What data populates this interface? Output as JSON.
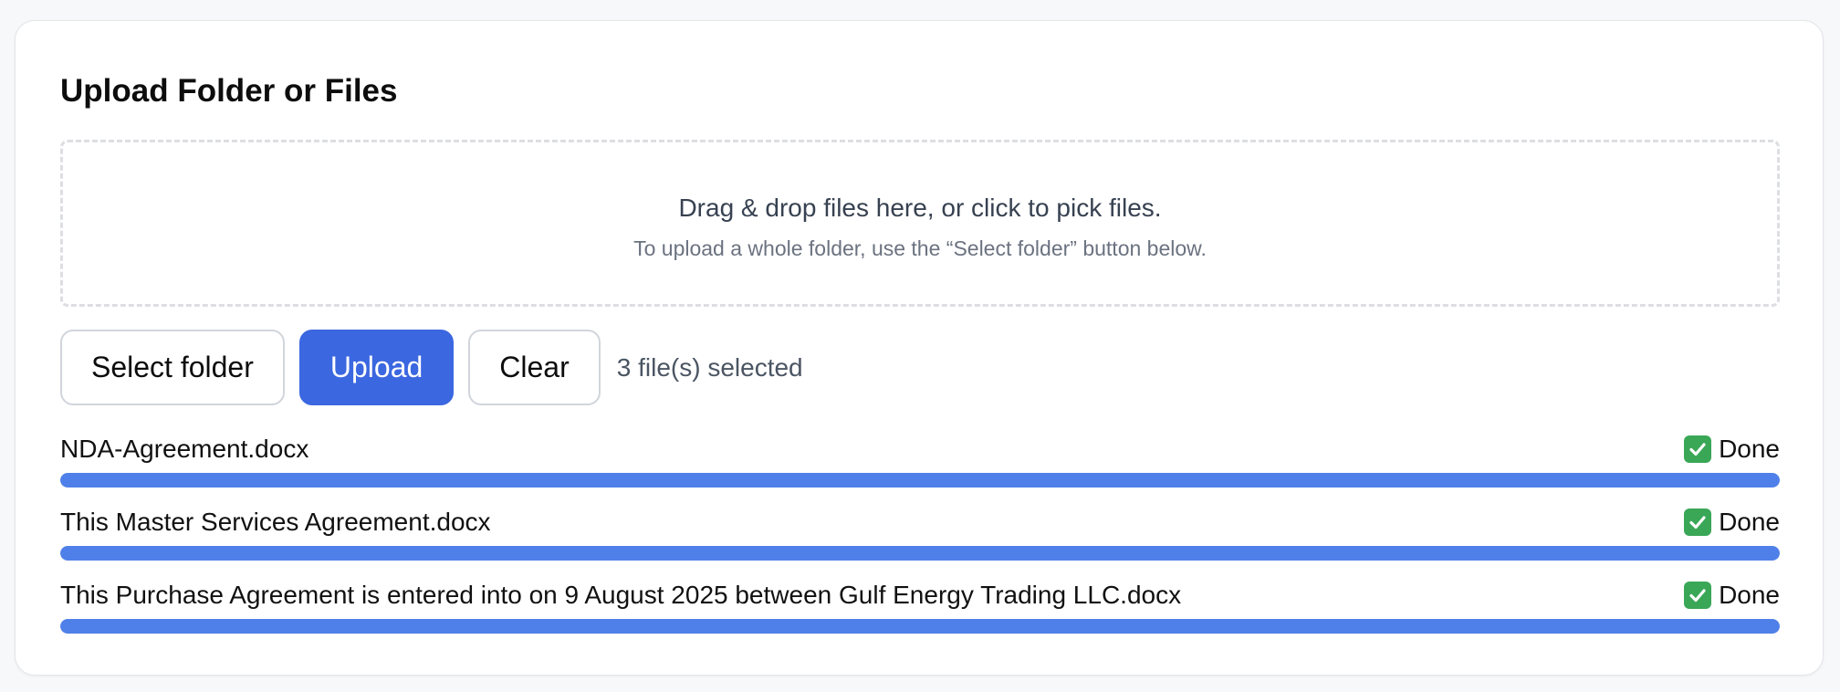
{
  "panel": {
    "title": "Upload Folder or Files"
  },
  "dropzone": {
    "primary_text": "Drag & drop files here, or click to pick files.",
    "secondary_text": "To upload a whole folder, use the “Select folder” button below."
  },
  "actions": {
    "select_folder_label": "Select folder",
    "upload_label": "Upload",
    "clear_label": "Clear",
    "selection_count": "3 file(s) selected"
  },
  "files": [
    {
      "name": "NDA-Agreement.docx",
      "status": "Done",
      "status_icon": "check-mark-icon",
      "progress": 1.0
    },
    {
      "name": "This Master Services Agreement.docx",
      "status": "Done",
      "status_icon": "check-mark-icon",
      "progress": 1.0
    },
    {
      "name": "This Purchase Agreement is entered into on 9 August 2025 between Gulf Energy Trading LLC.docx",
      "status": "Done",
      "status_icon": "check-mark-icon",
      "progress": 1.0
    }
  ],
  "colors": {
    "accent": "#3b67e0",
    "progress": "#4f80e9",
    "success": "#3aa757"
  }
}
